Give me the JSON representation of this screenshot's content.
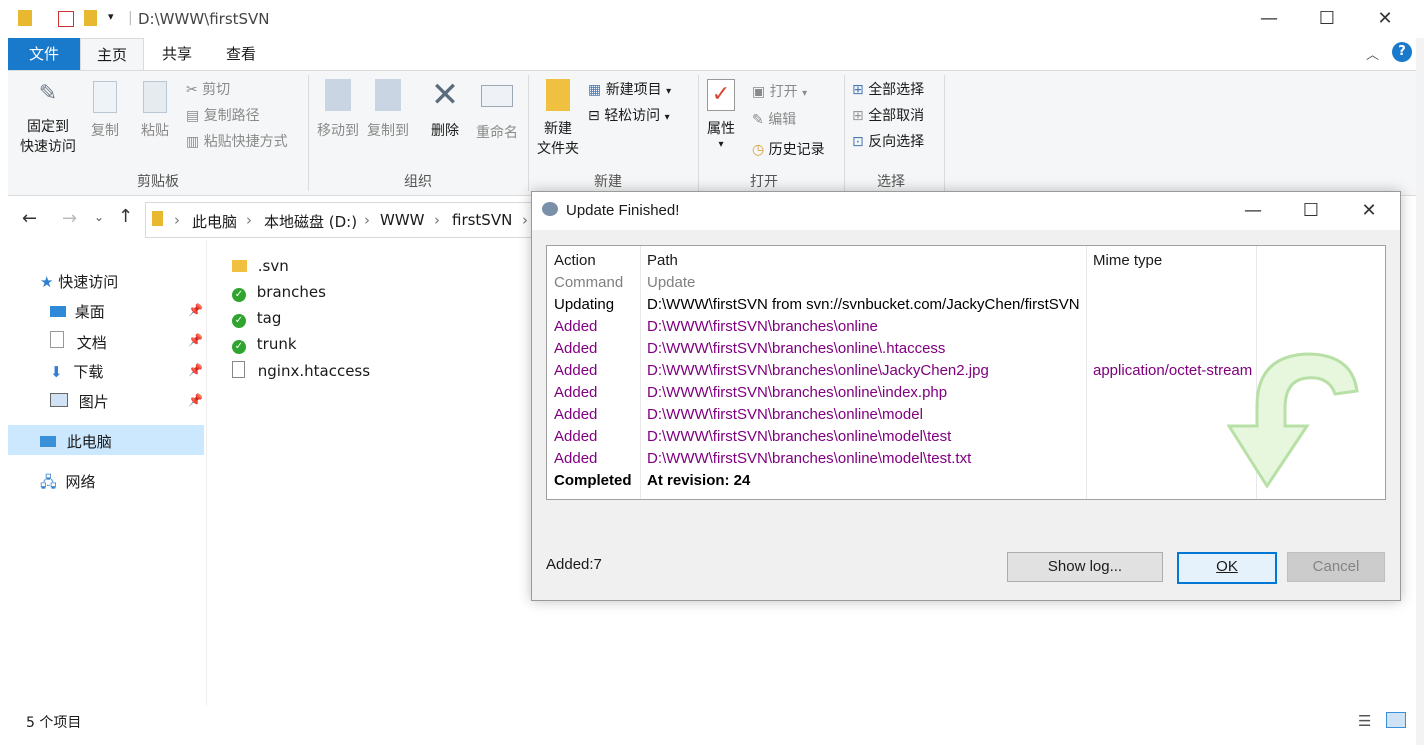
{
  "window": {
    "path_title": "D:\\WWW\\firstSVN"
  },
  "ribbon": {
    "tabs": [
      "文件",
      "主页",
      "共享",
      "查看"
    ],
    "clipboard": {
      "pin": [
        "固定到",
        "快速访问"
      ],
      "copy": "复制",
      "paste": "粘贴",
      "cut": "剪切",
      "copy_path": "复制路径",
      "paste_shortcut": "粘贴快捷方式",
      "label": "剪贴板"
    },
    "organize": {
      "move_to": "移动到",
      "copy_to": "复制到",
      "delete": "删除",
      "rename": "重命名",
      "label": "组织"
    },
    "new": {
      "new_folder": [
        "新建",
        "文件夹"
      ],
      "new_item": "新建项目",
      "easy_access": "轻松访问",
      "label": "新建"
    },
    "open": {
      "properties": "属性",
      "open": "打开",
      "edit": "编辑",
      "history": "历史记录",
      "label": "打开"
    },
    "select": {
      "select_all": "全部选择",
      "select_none": "全部取消",
      "invert": "反向选择",
      "label": "选择"
    }
  },
  "address": {
    "crumbs": [
      "此电脑",
      "本地磁盘 (D:)",
      "WWW",
      "firstSVN"
    ]
  },
  "nav": {
    "quick_access": "快速访问",
    "items": [
      "桌面",
      "文档",
      "下载",
      "图片"
    ],
    "this_pc": "此电脑",
    "network": "网络"
  },
  "files": [
    ".svn",
    "branches",
    "tag",
    "trunk",
    "nginx.htaccess"
  ],
  "status": {
    "count": "5 个项目"
  },
  "dialog": {
    "title": "Update Finished!",
    "columns": [
      "Action",
      "Path",
      "Mime type"
    ],
    "rows": [
      {
        "action": "Command",
        "path": "Update",
        "mime": ""
      },
      {
        "action": "Updating",
        "path": "D:\\WWW\\firstSVN from svn://svnbucket.com/JackyChen/firstSVN",
        "mime": ""
      },
      {
        "action": "Added",
        "path": "D:\\WWW\\firstSVN\\branches\\online",
        "mime": ""
      },
      {
        "action": "Added",
        "path": "D:\\WWW\\firstSVN\\branches\\online\\.htaccess",
        "mime": ""
      },
      {
        "action": "Added",
        "path": "D:\\WWW\\firstSVN\\branches\\online\\JackyChen2.jpg",
        "mime": "application/octet-stream"
      },
      {
        "action": "Added",
        "path": "D:\\WWW\\firstSVN\\branches\\online\\index.php",
        "mime": ""
      },
      {
        "action": "Added",
        "path": "D:\\WWW\\firstSVN\\branches\\online\\model",
        "mime": ""
      },
      {
        "action": "Added",
        "path": "D:\\WWW\\firstSVN\\branches\\online\\model\\test",
        "mime": ""
      },
      {
        "action": "Added",
        "path": "D:\\WWW\\firstSVN\\branches\\online\\model\\test.txt",
        "mime": ""
      },
      {
        "action": "Completed",
        "path": "At revision: 24",
        "mime": ""
      }
    ],
    "summary": "Added:7",
    "buttons": {
      "show_log": "Show log...",
      "ok": "OK",
      "cancel": "Cancel"
    },
    "colors": {
      "added": "#800080",
      "command": "#808080",
      "updating": "#000000"
    }
  }
}
